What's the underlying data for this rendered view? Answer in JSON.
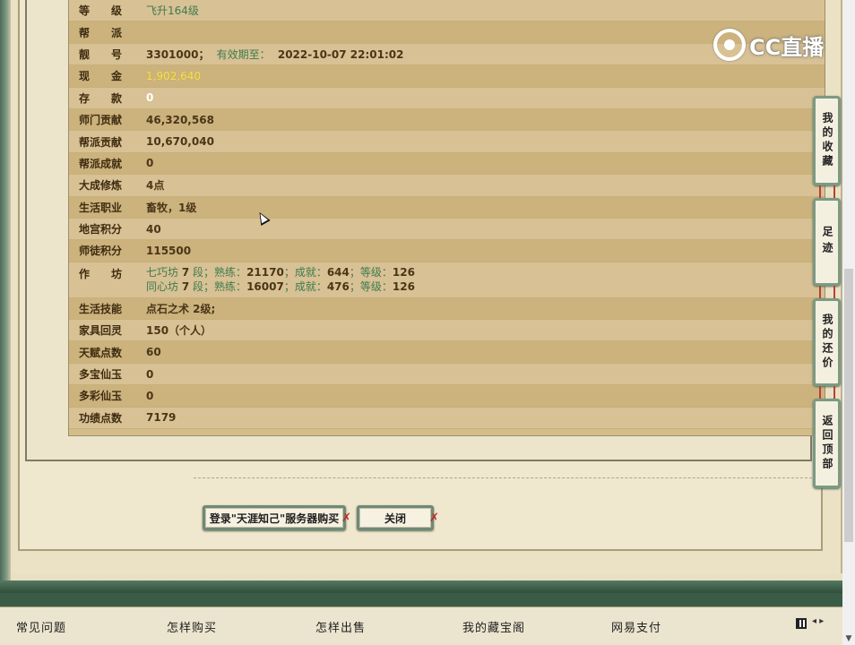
{
  "rows": [
    {
      "label": "等　　级",
      "value": "飞升164级"
    },
    {
      "label": "帮　　派",
      "value": ""
    },
    {
      "label": "靓　　号",
      "value": "3301000；",
      "extra_label": "有效期至：",
      "extra_value": "2022-10-07 22:01:02"
    },
    {
      "label": "现　　金",
      "value": "1,902,640"
    },
    {
      "label": "存　　款",
      "value": "0"
    },
    {
      "label": "师门贡献",
      "value": "46,320,568"
    },
    {
      "label": "帮派贡献",
      "value": "10,670,040"
    },
    {
      "label": "帮派成就",
      "value": "0"
    },
    {
      "label": "大成修炼",
      "value": "4点"
    },
    {
      "label": "生活职业",
      "value": "畜牧，1级"
    },
    {
      "label": "地宫积分",
      "value": "40"
    },
    {
      "label": "师徒积分",
      "value": "115500"
    }
  ],
  "workshop": {
    "label": "作　　坊",
    "lines": [
      {
        "name": "七巧坊",
        "level": "7",
        "seg": "段；",
        "skill_label": "熟练：",
        "skill": "21170",
        "achv_label": "；成就：",
        "achv": "644",
        "grade_label": "；等级：",
        "grade": "126"
      },
      {
        "name": "同心坊",
        "level": "7",
        "seg": "段；",
        "skill_label": "熟练：",
        "skill": "16007",
        "achv_label": "；成就：",
        "achv": "476",
        "grade_label": "；等级：",
        "grade": "126"
      }
    ]
  },
  "rows2": [
    {
      "label": "生活技能",
      "value": "点石之术 2级;"
    },
    {
      "label": "家具回灵",
      "value": "150（个人）"
    },
    {
      "label": "天赋点数",
      "value": "60"
    },
    {
      "label": "多宝仙玉",
      "value": "0"
    },
    {
      "label": "多彩仙玉",
      "value": "0"
    },
    {
      "label": "功绩点数",
      "value": "7179"
    }
  ],
  "buttons": {
    "login": "登录\"天涯知己\"服务器购买",
    "close": "关闭"
  },
  "side_tabs": {
    "favorites": "我的收藏",
    "footprints": "足迹",
    "bargain": "我的还价",
    "back_top": "返回顶部"
  },
  "footer": {
    "faq": "常见问题",
    "how_buy": "怎样购买",
    "how_sell": "怎样出售",
    "my_treasure": "我的藏宝阁",
    "netease_pay": "网易支付"
  },
  "logo_text": "CC直播",
  "colors": {
    "green_value": "#3e7b4f",
    "cash_yellow": "#f3e24c",
    "tab_border": "#7d9a83"
  }
}
